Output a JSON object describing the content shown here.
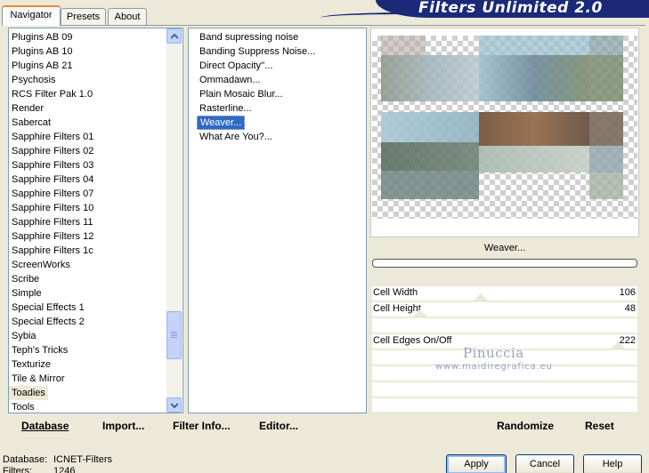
{
  "app_title": "Filters Unlimited 2.0",
  "tabs": [
    {
      "label": "Navigator"
    },
    {
      "label": "Presets"
    },
    {
      "label": "About"
    }
  ],
  "categories": [
    "Plugins AB 09",
    "Plugins AB 10",
    "Plugins AB 21",
    "Psychosis",
    "RCS Filter Pak 1.0",
    "Render",
    "Sabercat",
    "Sapphire Filters 01",
    "Sapphire Filters 02",
    "Sapphire Filters 03",
    "Sapphire Filters 04",
    "Sapphire Filters 07",
    "Sapphire Filters 10",
    "Sapphire Filters 11",
    "Sapphire Filters 12",
    "Sapphire Filters 1c",
    "ScreenWorks",
    "Scribe",
    "Simple",
    "Special Effects 1",
    "Special Effects 2",
    "Sybia",
    "Teph's Tricks",
    "Texturize",
    "Tile & Mirror",
    "Toadies",
    "Tools"
  ],
  "selected_category": "Toadies",
  "filters": [
    "Band supressing noise",
    "Banding Suppress Noise...",
    "Direct Opacity''...",
    "Ommadawn...",
    "Plain Mosaic Blur...",
    "Rasterline...",
    "Weaver...",
    "What Are You?..."
  ],
  "selected_filter": "Weaver...",
  "current_filter_name": "Weaver...",
  "sliders": [
    {
      "label": "Cell Width",
      "value": "106"
    },
    {
      "label": "Cell Height",
      "value": "48"
    },
    {
      "label": "Cell Edges On/Off",
      "value": "222"
    }
  ],
  "watermark": {
    "name": "Pinuccia",
    "url": "www.maidiregrafica.eu"
  },
  "left_actions": {
    "database": "Database",
    "import": "Import...",
    "filter_info": "Filter Info...",
    "editor": "Editor..."
  },
  "right_actions": {
    "randomize": "Randomize",
    "reset": "Reset"
  },
  "status": {
    "database_label": "Database:",
    "database_value": "ICNET-Filters",
    "filters_label": "Filters:",
    "filters_value": "1246"
  },
  "dialog_buttons": {
    "apply": "Apply",
    "cancel": "Cancel",
    "help": "Help"
  },
  "colors": {
    "selection": "#316ac5",
    "banner": "#1a2a78",
    "tab_accent": "#e68b2c"
  }
}
